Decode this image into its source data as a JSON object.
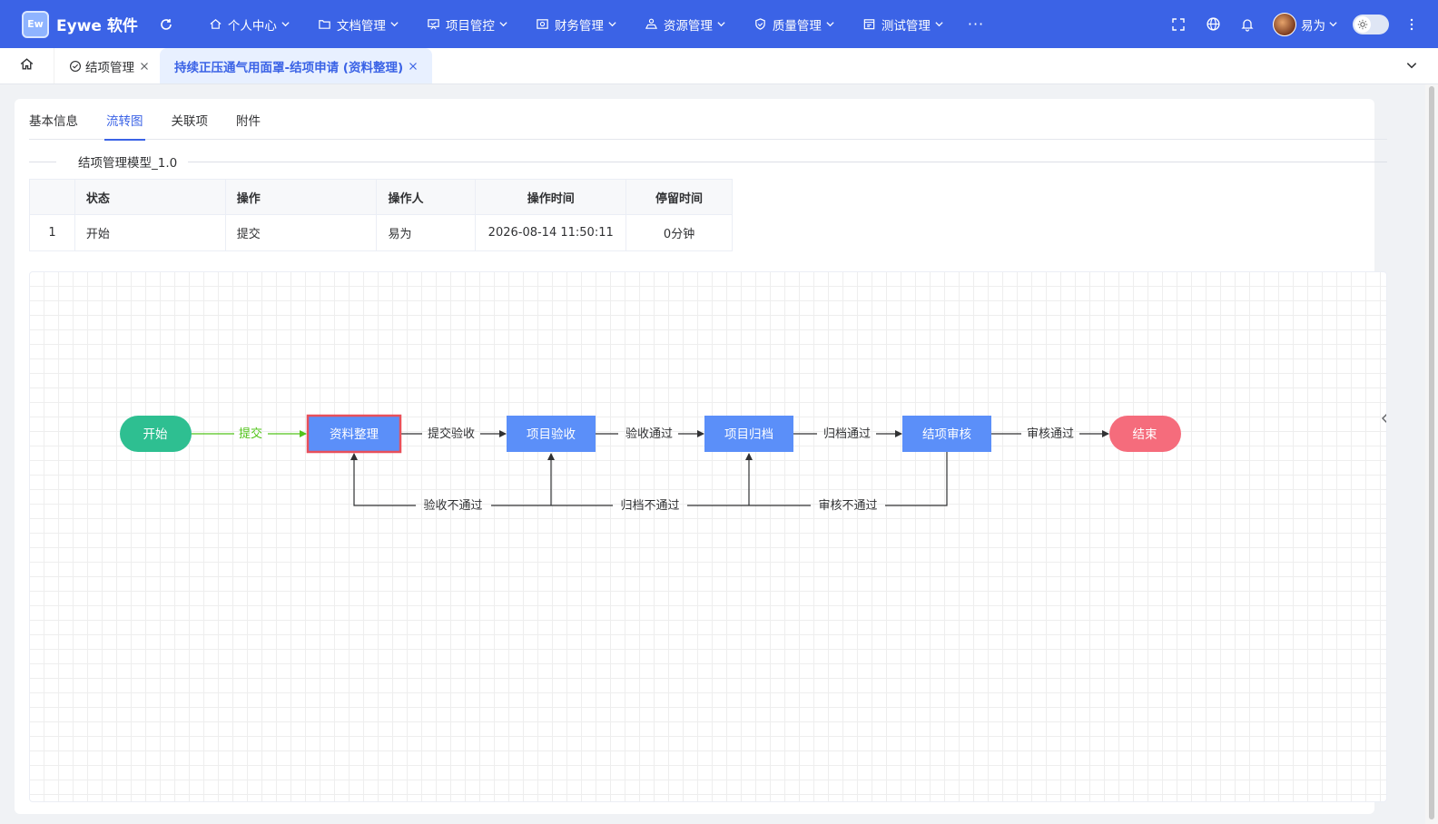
{
  "app": {
    "logo_mark": "Ew",
    "name": "Eywe 软件"
  },
  "nav": {
    "menus": [
      {
        "label": "个人中心",
        "icon": "home-icon"
      },
      {
        "label": "文档管理",
        "icon": "folder-icon"
      },
      {
        "label": "项目管控",
        "icon": "project-icon"
      },
      {
        "label": "财务管理",
        "icon": "finance-icon"
      },
      {
        "label": "资源管理",
        "icon": "resource-icon"
      },
      {
        "label": "质量管理",
        "icon": "shield-icon"
      },
      {
        "label": "测试管理",
        "icon": "calendar-icon"
      }
    ],
    "more": "···",
    "user_name": "易为"
  },
  "tabs": {
    "items": [
      {
        "label": "结项管理"
      },
      {
        "label": "持续正压通气用面罩-结项申请 (资料整理)"
      }
    ]
  },
  "detail_tabs": [
    "基本信息",
    "流转图",
    "关联项",
    "附件"
  ],
  "model_title": "结项管理模型_1.0",
  "log_table": {
    "headers": [
      "",
      "状态",
      "操作",
      "操作人",
      "操作时间",
      "停留时间"
    ],
    "rows": [
      [
        "1",
        "开始",
        "提交",
        "易为",
        "2026-08-14 11:50:11",
        "0分钟"
      ]
    ]
  },
  "flow": {
    "nodes": {
      "start": "开始",
      "organize": "资料整理",
      "acceptance": "项目验收",
      "archive": "项目归档",
      "review": "结项审核",
      "end": "结束"
    },
    "edges": {
      "submit": "提交",
      "submit_acceptance": "提交验收",
      "acceptance_pass": "验收通过",
      "archive_pass": "归档通过",
      "review_pass": "审核通过",
      "acceptance_fail": "验收不通过",
      "archive_fail": "归档不通过",
      "review_fail": "审核不通过"
    },
    "colors": {
      "start": "#2ebf91",
      "end": "#f56c7c",
      "task": "#5b8ff9",
      "current_border": "#e8505b",
      "passed_edge": "#52c41a"
    }
  }
}
